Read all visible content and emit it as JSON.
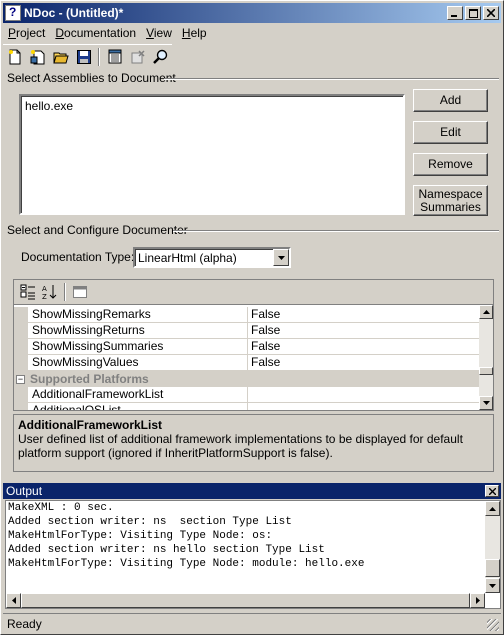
{
  "window": {
    "title": "NDoc - (Untitled)*"
  },
  "menu": [
    {
      "label": "Project",
      "key": "P"
    },
    {
      "label": "Documentation",
      "key": "D"
    },
    {
      "label": "View",
      "key": "V"
    },
    {
      "label": "Help",
      "key": "H"
    }
  ],
  "toolbar": {
    "icons": [
      "new-icon",
      "new-from-template-icon",
      "open-icon",
      "save-icon",
      "build-icon",
      "cancel-build-icon",
      "view-icon"
    ]
  },
  "assemblies": {
    "section_label": "Select Assemblies to Document",
    "items": [
      "hello.exe"
    ],
    "buttons": {
      "add": "Add",
      "edit": "Edit",
      "remove": "Remove",
      "namespace_line1": "Namespace",
      "namespace_line2": "Summaries"
    }
  },
  "documenter": {
    "section_label": "Select and Configure Documenter",
    "type_label": "Documentation Type:",
    "type_value": "LinearHtml (alpha)"
  },
  "property_grid": {
    "rows": [
      {
        "name": "ShowMissingRemarks",
        "value": "False"
      },
      {
        "name": "ShowMissingReturns",
        "value": "False"
      },
      {
        "name": "ShowMissingSummaries",
        "value": "False"
      },
      {
        "name": "ShowMissingValues",
        "value": "False"
      }
    ],
    "category": "Supported Platforms",
    "category_rows": [
      {
        "name": "AdditionalFrameworkList",
        "value": ""
      },
      {
        "name": "AdditionalOSList",
        "value": ""
      }
    ],
    "description_title": "AdditionalFrameworkList",
    "description_text": "User defined list of additional framework implementations to be displayed for default platform support (ignored if InheritPlatformSupport is false)."
  },
  "output": {
    "title": "Output",
    "lines": [
      "MakeXML : 0 sec.",
      "Added section writer: ns  section Type List",
      "MakeHtmlForType: Visiting Type Node: os:",
      "Added section writer: ns hello section Type List",
      "MakeHtmlForType: Visiting Type Node: module: hello.exe"
    ]
  },
  "status": {
    "text": "Ready"
  }
}
